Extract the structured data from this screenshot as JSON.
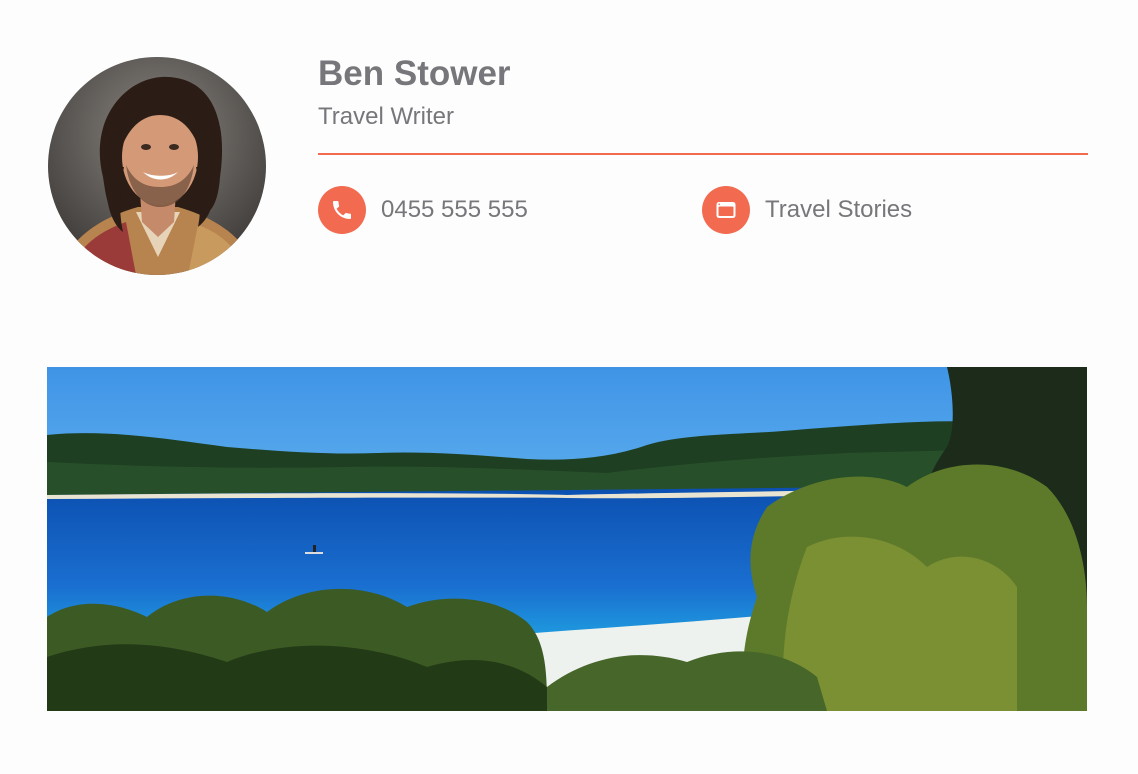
{
  "profile": {
    "name": "Ben Stower",
    "title": "Travel Writer"
  },
  "contacts": {
    "phone": {
      "icon": "phone-icon",
      "text": "0455 555 555"
    },
    "website": {
      "icon": "browser-window-icon",
      "text": "Travel Stories"
    }
  },
  "colors": {
    "accent": "#f26a4f",
    "text": "#77777b",
    "background": "#fdfdfd"
  }
}
